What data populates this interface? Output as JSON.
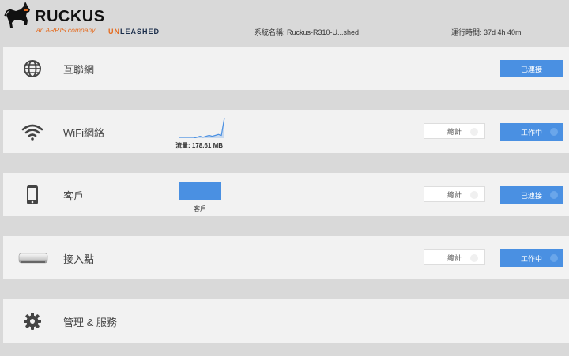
{
  "header": {
    "logo_word": "RUCKUS",
    "logo_tag": "an ARRIS company",
    "brand_un": "UN",
    "brand_leashed": "LEASHED",
    "system_name": "系統名稱: Ruckus-R310-U...shed",
    "uptime": "運行時間: 37d 4h 40m"
  },
  "panels": {
    "internet": {
      "title": "互聯網",
      "status_label": "已連接"
    },
    "wifi": {
      "title": "WiFi網絡",
      "traffic_label": "流量: 178.61 MB",
      "stats_label": "總計",
      "status_label": "工作中",
      "sparkline": [
        0,
        0,
        0,
        0,
        0,
        0,
        1,
        2,
        1,
        2,
        3,
        2,
        3,
        4,
        3,
        22
      ]
    },
    "clients": {
      "title": "客戶",
      "bar_label": "客戶",
      "stats_label": "總計",
      "status_label": "已連接"
    },
    "aps": {
      "title": "接入點",
      "stats_label": "總計",
      "status_label": "工作中"
    },
    "admin": {
      "title": "管理 & 服務"
    }
  },
  "colors": {
    "accent": "#4a90e2",
    "brand_orange": "#e56b1f",
    "panel_bg": "#f2f2f2",
    "page_bg": "#d9d9d9"
  },
  "icons": {
    "internet": "globe-icon",
    "wifi": "wifi-icon",
    "clients": "phone-icon",
    "aps": "access-point-icon",
    "admin": "gear-icon",
    "logo": "dog-icon"
  }
}
